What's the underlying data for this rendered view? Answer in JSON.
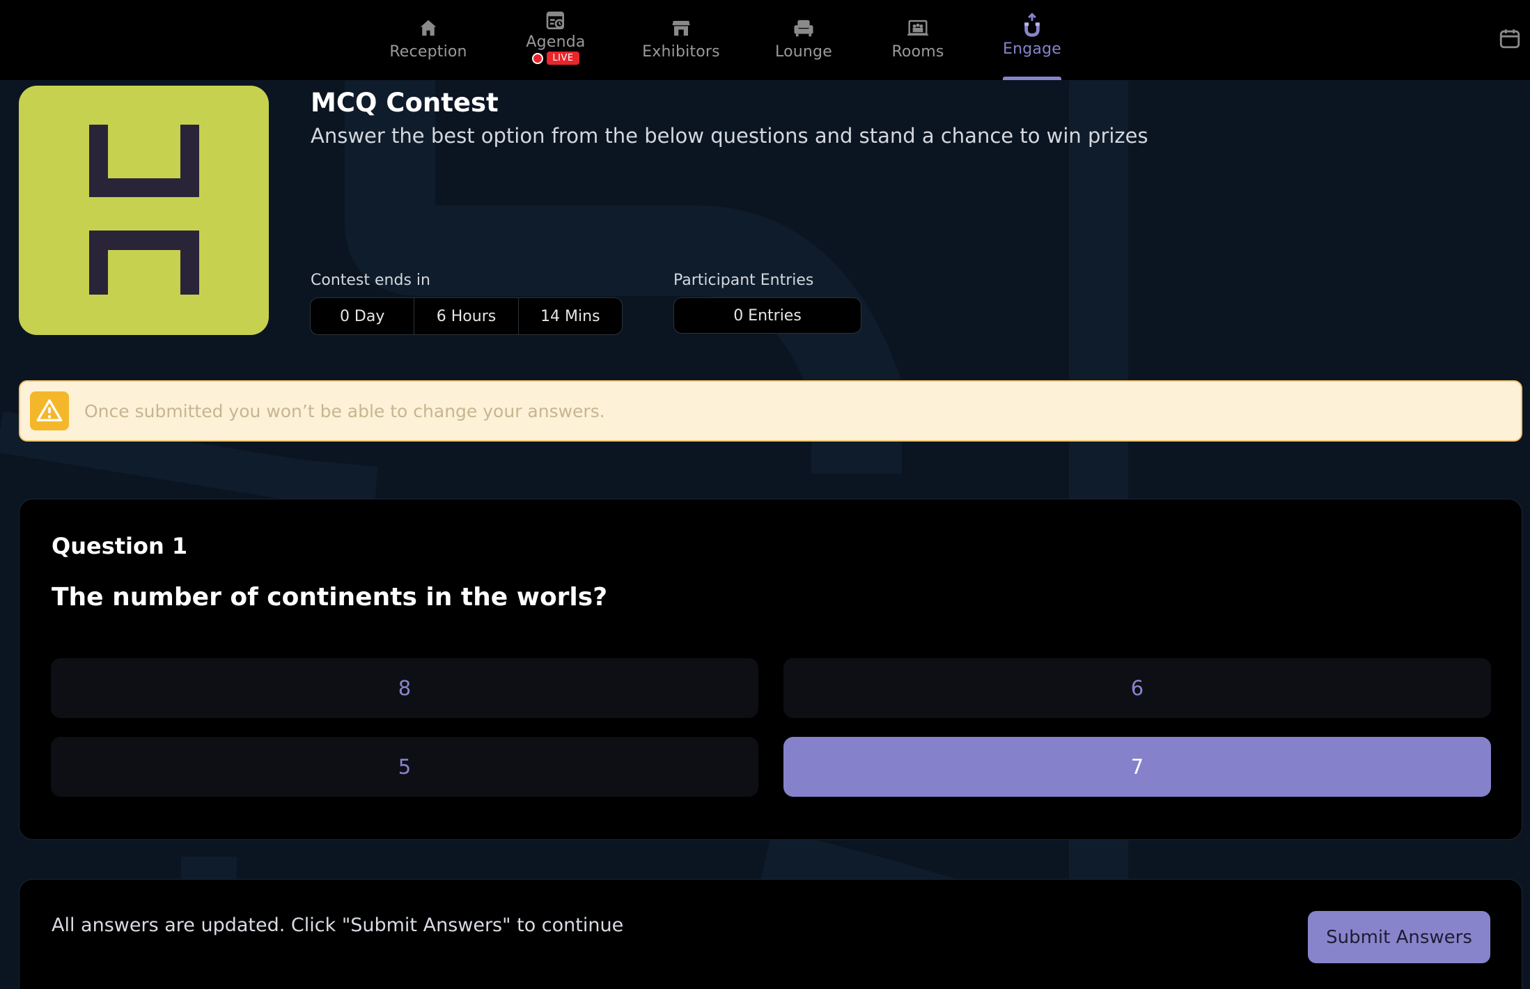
{
  "nav": {
    "items": [
      {
        "label": "Reception",
        "icon": "home-icon"
      },
      {
        "label": "Agenda",
        "icon": "agenda-icon",
        "badge": "LIVE"
      },
      {
        "label": "Exhibitors",
        "icon": "store-icon"
      },
      {
        "label": "Lounge",
        "icon": "armchair-icon"
      },
      {
        "label": "Rooms",
        "icon": "rooms-icon"
      },
      {
        "label": "Engage",
        "icon": "engage-icon",
        "active": true
      }
    ],
    "calendar_icon": "calendar-icon"
  },
  "contest": {
    "title": "MCQ Contest",
    "description": "Answer the best option from the below questions and stand a chance to win prizes",
    "ends_label": "Contest ends in",
    "timer": {
      "days": "0 Day",
      "hours": "6 Hours",
      "mins": "14 Mins"
    },
    "entries_label": "Participant Entries",
    "entries_value": "0 Entries"
  },
  "warning": {
    "text": "Once submitted you won’t be able to change your answers.",
    "icon": "warning-icon"
  },
  "question": {
    "number_label": "Question 1",
    "text": "The number of continents in the worls?",
    "options": [
      "8",
      "6",
      "5",
      "7"
    ],
    "selected_index": 3
  },
  "footer": {
    "status_text": "All answers are updated. Click \"Submit Answers\" to continue",
    "submit_label": "Submit Answers"
  },
  "colors": {
    "accent": "#8884cc",
    "live_red": "#e8262c",
    "logo_bg": "#c6d14f",
    "logo_mark": "#2a2438",
    "warning_bg": "#fdf1d8",
    "warning_icon": "#f5b72a"
  }
}
